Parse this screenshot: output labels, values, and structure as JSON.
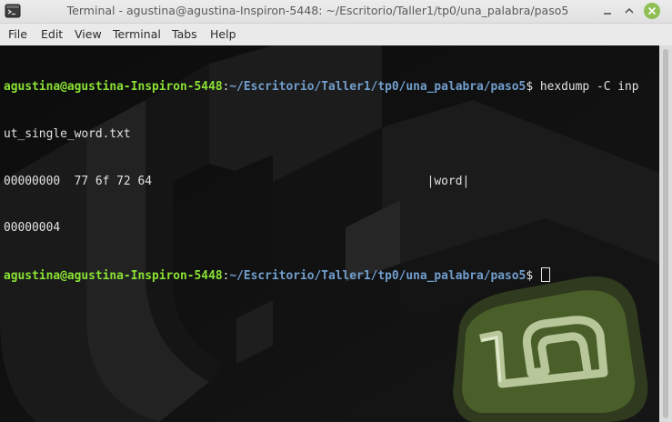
{
  "window": {
    "title": "Terminal - agustina@agustina-Inspiron-5448: ~/Escritorio/Taller1/tp0/una_palabra/paso5",
    "accent_color": "#8fbf54"
  },
  "menu": {
    "items": [
      "File",
      "Edit",
      "View",
      "Terminal",
      "Tabs",
      "Help"
    ]
  },
  "terminal": {
    "prompt_user": "agustina@agustina-Inspiron-5448",
    "prompt_sep": ":",
    "prompt_path": "~/Escritorio/Taller1/tp0/una_palabra/paso5",
    "prompt_symbol": "$ ",
    "command_part1": "hexdump -C inp",
    "command_part2": "ut_single_word.txt",
    "output_line1": "00000000  77 6f 72 64                                       |word|",
    "output_line2": "00000004",
    "user_color": "#8ae234",
    "path_color": "#729fcf"
  },
  "icons": {
    "app": "terminal-icon",
    "minimize": "minimize-icon",
    "maximize": "maximize-icon",
    "close": "close-icon",
    "wallpaper_logo": "linux-mint-logo"
  }
}
